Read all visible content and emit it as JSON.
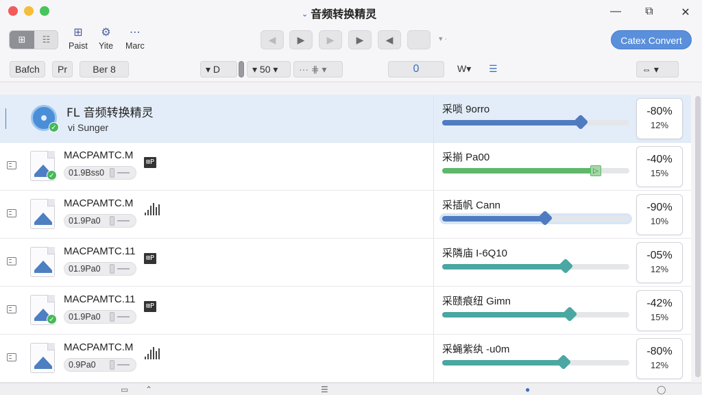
{
  "window": {
    "title": "音频转换精灵",
    "title_chevron": "⌄",
    "minimize": "—",
    "maximize": "⧉",
    "close": "✕"
  },
  "toolbar": {
    "view_grid": "⊞",
    "view_list": "☷",
    "items": [
      {
        "icon": "⊞",
        "label": "Paist"
      },
      {
        "icon": "⚙",
        "label": "Yite"
      },
      {
        "icon": "⋯",
        "label": "Marc"
      }
    ],
    "playback": [
      {
        "icon": "◀"
      },
      {
        "icon": "▶"
      },
      {
        "icon": "▶"
      },
      {
        "icon": "▶"
      },
      {
        "icon": "◀"
      },
      {
        "icon": ""
      }
    ],
    "more": "▾ ·",
    "convert_label": "Catex Convert"
  },
  "options": {
    "batch": "Bafch",
    "pr": "Pr",
    "ber": "Ber 8",
    "d_select": "▾ D",
    "rate_select": "▾ 50 ▾",
    "mid_select": "··· ⋕ ▾",
    "value": "0",
    "w_select": "W▾",
    "list_icon": "☰",
    "right_select": "⇔ ▾"
  },
  "rows": [
    {
      "title": "FL 音频转换精灵",
      "sub": "vi Sunger",
      "stage": "采唢 9orro",
      "progress": 0.74,
      "color": "#4f7bc0",
      "pct": "-80%",
      "pct2": "12%",
      "selected": true
    },
    {
      "title": "MACPAMTC.M",
      "size": "01.9Bss0",
      "badge": "⊞P",
      "stage": "采揃 Pa00",
      "progress": 0.82,
      "color": "#5fb86a",
      "pct": "-40%",
      "pct2": "15%",
      "checked": true
    },
    {
      "title": "MACPAMTC.M",
      "size": "01.9Pa0",
      "stage": "采插帆 Cann",
      "progress": 0.55,
      "color": "#4f7bc0",
      "pct": "-90%",
      "pct2": "10%",
      "wave": true
    },
    {
      "title": "MACPAMTC.11",
      "size": "01.9Pa0",
      "badge": "⊞P",
      "stage": "采隣庙 I-6Q10",
      "progress": 0.66,
      "color": "#4aa7a2",
      "pct": "-05%",
      "pct2": "12%"
    },
    {
      "title": "MACPAMTC.11",
      "size": "01.9Pa0",
      "badge": "⊞P",
      "stage": "采赜痕纽 Gimn",
      "progress": 0.68,
      "color": "#4aa7a2",
      "pct": "-42%",
      "pct2": "15%",
      "checked": true
    },
    {
      "title": "MACPAMTC.M",
      "size": "0.9Pa0",
      "stage": "采蝇紫纨 -u0m",
      "progress": 0.65,
      "color": "#4aa7a2",
      "pct": "-80%",
      "pct2": "12%",
      "wave": true
    }
  ],
  "colors": {
    "accent": "#5a8fdc",
    "selected_row": "#e3edf9",
    "check": "#46b95c"
  }
}
